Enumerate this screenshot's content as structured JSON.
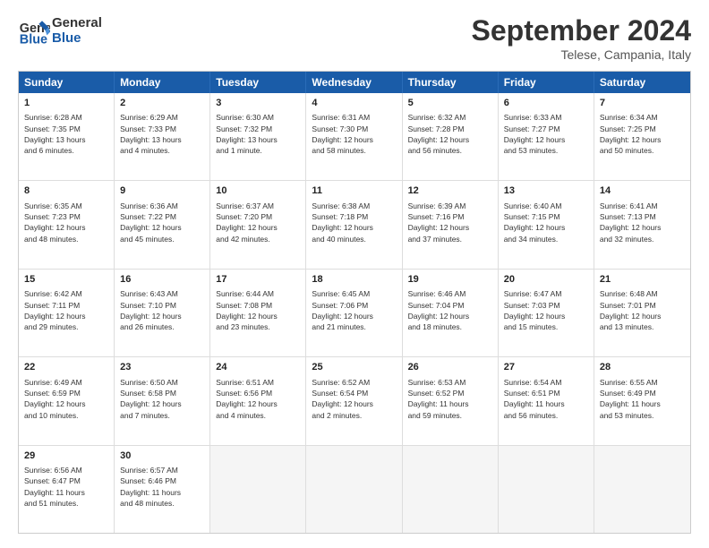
{
  "header": {
    "logo_line1": "General",
    "logo_line2": "Blue",
    "month": "September 2024",
    "location": "Telese, Campania, Italy"
  },
  "weekdays": [
    "Sunday",
    "Monday",
    "Tuesday",
    "Wednesday",
    "Thursday",
    "Friday",
    "Saturday"
  ],
  "rows": [
    [
      {
        "day": "1",
        "lines": [
          "Sunrise: 6:28 AM",
          "Sunset: 7:35 PM",
          "Daylight: 13 hours",
          "and 6 minutes."
        ]
      },
      {
        "day": "2",
        "lines": [
          "Sunrise: 6:29 AM",
          "Sunset: 7:33 PM",
          "Daylight: 13 hours",
          "and 4 minutes."
        ]
      },
      {
        "day": "3",
        "lines": [
          "Sunrise: 6:30 AM",
          "Sunset: 7:32 PM",
          "Daylight: 13 hours",
          "and 1 minute."
        ]
      },
      {
        "day": "4",
        "lines": [
          "Sunrise: 6:31 AM",
          "Sunset: 7:30 PM",
          "Daylight: 12 hours",
          "and 58 minutes."
        ]
      },
      {
        "day": "5",
        "lines": [
          "Sunrise: 6:32 AM",
          "Sunset: 7:28 PM",
          "Daylight: 12 hours",
          "and 56 minutes."
        ]
      },
      {
        "day": "6",
        "lines": [
          "Sunrise: 6:33 AM",
          "Sunset: 7:27 PM",
          "Daylight: 12 hours",
          "and 53 minutes."
        ]
      },
      {
        "day": "7",
        "lines": [
          "Sunrise: 6:34 AM",
          "Sunset: 7:25 PM",
          "Daylight: 12 hours",
          "and 50 minutes."
        ]
      }
    ],
    [
      {
        "day": "8",
        "lines": [
          "Sunrise: 6:35 AM",
          "Sunset: 7:23 PM",
          "Daylight: 12 hours",
          "and 48 minutes."
        ]
      },
      {
        "day": "9",
        "lines": [
          "Sunrise: 6:36 AM",
          "Sunset: 7:22 PM",
          "Daylight: 12 hours",
          "and 45 minutes."
        ]
      },
      {
        "day": "10",
        "lines": [
          "Sunrise: 6:37 AM",
          "Sunset: 7:20 PM",
          "Daylight: 12 hours",
          "and 42 minutes."
        ]
      },
      {
        "day": "11",
        "lines": [
          "Sunrise: 6:38 AM",
          "Sunset: 7:18 PM",
          "Daylight: 12 hours",
          "and 40 minutes."
        ]
      },
      {
        "day": "12",
        "lines": [
          "Sunrise: 6:39 AM",
          "Sunset: 7:16 PM",
          "Daylight: 12 hours",
          "and 37 minutes."
        ]
      },
      {
        "day": "13",
        "lines": [
          "Sunrise: 6:40 AM",
          "Sunset: 7:15 PM",
          "Daylight: 12 hours",
          "and 34 minutes."
        ]
      },
      {
        "day": "14",
        "lines": [
          "Sunrise: 6:41 AM",
          "Sunset: 7:13 PM",
          "Daylight: 12 hours",
          "and 32 minutes."
        ]
      }
    ],
    [
      {
        "day": "15",
        "lines": [
          "Sunrise: 6:42 AM",
          "Sunset: 7:11 PM",
          "Daylight: 12 hours",
          "and 29 minutes."
        ]
      },
      {
        "day": "16",
        "lines": [
          "Sunrise: 6:43 AM",
          "Sunset: 7:10 PM",
          "Daylight: 12 hours",
          "and 26 minutes."
        ]
      },
      {
        "day": "17",
        "lines": [
          "Sunrise: 6:44 AM",
          "Sunset: 7:08 PM",
          "Daylight: 12 hours",
          "and 23 minutes."
        ]
      },
      {
        "day": "18",
        "lines": [
          "Sunrise: 6:45 AM",
          "Sunset: 7:06 PM",
          "Daylight: 12 hours",
          "and 21 minutes."
        ]
      },
      {
        "day": "19",
        "lines": [
          "Sunrise: 6:46 AM",
          "Sunset: 7:04 PM",
          "Daylight: 12 hours",
          "and 18 minutes."
        ]
      },
      {
        "day": "20",
        "lines": [
          "Sunrise: 6:47 AM",
          "Sunset: 7:03 PM",
          "Daylight: 12 hours",
          "and 15 minutes."
        ]
      },
      {
        "day": "21",
        "lines": [
          "Sunrise: 6:48 AM",
          "Sunset: 7:01 PM",
          "Daylight: 12 hours",
          "and 13 minutes."
        ]
      }
    ],
    [
      {
        "day": "22",
        "lines": [
          "Sunrise: 6:49 AM",
          "Sunset: 6:59 PM",
          "Daylight: 12 hours",
          "and 10 minutes."
        ]
      },
      {
        "day": "23",
        "lines": [
          "Sunrise: 6:50 AM",
          "Sunset: 6:58 PM",
          "Daylight: 12 hours",
          "and 7 minutes."
        ]
      },
      {
        "day": "24",
        "lines": [
          "Sunrise: 6:51 AM",
          "Sunset: 6:56 PM",
          "Daylight: 12 hours",
          "and 4 minutes."
        ]
      },
      {
        "day": "25",
        "lines": [
          "Sunrise: 6:52 AM",
          "Sunset: 6:54 PM",
          "Daylight: 12 hours",
          "and 2 minutes."
        ]
      },
      {
        "day": "26",
        "lines": [
          "Sunrise: 6:53 AM",
          "Sunset: 6:52 PM",
          "Daylight: 11 hours",
          "and 59 minutes."
        ]
      },
      {
        "day": "27",
        "lines": [
          "Sunrise: 6:54 AM",
          "Sunset: 6:51 PM",
          "Daylight: 11 hours",
          "and 56 minutes."
        ]
      },
      {
        "day": "28",
        "lines": [
          "Sunrise: 6:55 AM",
          "Sunset: 6:49 PM",
          "Daylight: 11 hours",
          "and 53 minutes."
        ]
      }
    ],
    [
      {
        "day": "29",
        "lines": [
          "Sunrise: 6:56 AM",
          "Sunset: 6:47 PM",
          "Daylight: 11 hours",
          "and 51 minutes."
        ]
      },
      {
        "day": "30",
        "lines": [
          "Sunrise: 6:57 AM",
          "Sunset: 6:46 PM",
          "Daylight: 11 hours",
          "and 48 minutes."
        ]
      },
      {
        "day": "",
        "lines": []
      },
      {
        "day": "",
        "lines": []
      },
      {
        "day": "",
        "lines": []
      },
      {
        "day": "",
        "lines": []
      },
      {
        "day": "",
        "lines": []
      }
    ]
  ]
}
